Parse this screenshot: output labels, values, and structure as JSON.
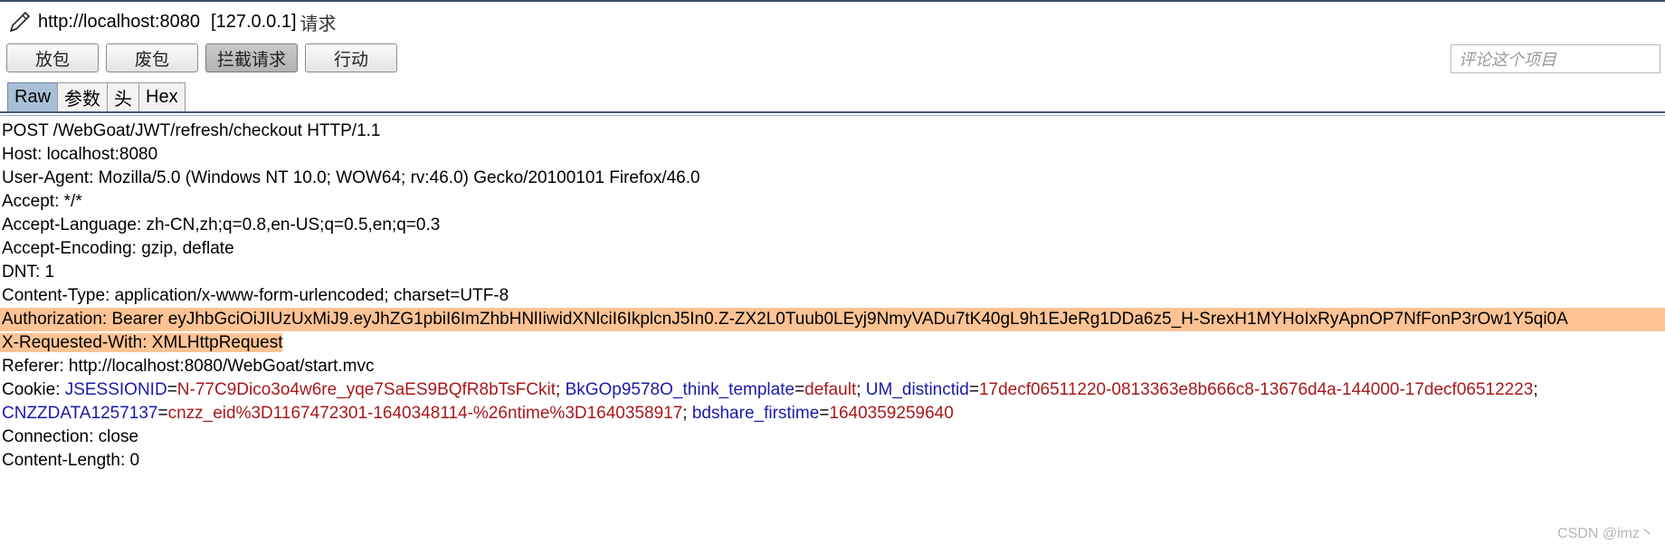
{
  "window": {
    "url": "http://localhost:8080",
    "ip": "[127.0.0.1]",
    "suffix": "请求"
  },
  "toolbar": {
    "forward": "放包",
    "drop": "废包",
    "intercept": "拦截请求",
    "action": "行动"
  },
  "comment": {
    "placeholder": "评论这个项目"
  },
  "tabs": [
    "Raw",
    "参数",
    "头",
    "Hex"
  ],
  "request": {
    "lines": [
      "POST /WebGoat/JWT/refresh/checkout HTTP/1.1",
      "Host: localhost:8080",
      "User-Agent: Mozilla/5.0 (Windows NT 10.0; WOW64; rv:46.0) Gecko/20100101 Firefox/46.0",
      "Accept: */*",
      "Accept-Language: zh-CN,zh;q=0.8,en-US;q=0.5,en;q=0.3",
      "Accept-Encoding: gzip, deflate",
      "DNT: 1",
      "Content-Type: application/x-www-form-urlencoded; charset=UTF-8",
      "Authorization: Bearer eyJhbGciOiJIUzUxMiJ9.eyJhZG1pbiI6ImZhbHNlIiwidXNlciI6IkplcnJ5In0.Z-ZX2L0Tuub0LEyj9NmyVADu7tK40gL9h1EJeRg1DDa6z5_H-SrexH1MYHoIxRyApnOP7NfFonP3rOw1Y5qi0A",
      "X-Requested-With: XMLHttpRequest",
      "Referer: http://localhost:8080/WebGoat/start.mvc"
    ],
    "cookie_label": "Cookie: ",
    "cookie_line1": {
      "n1": "JSESSIONID",
      "v1": "N-77C9Dico3o4w6re_yqe7SaES9BQfR8bTsFCkit",
      "n2": "BkGOp9578O_think_template",
      "v2": "default",
      "n3": "UM_distinctid",
      "v3": "17decf06511220-0813363e8b666c8-13676d4a-144000-17decf06512223"
    },
    "cookie_line2": {
      "n4": "CNZZDATA1257137",
      "v4": "cnzz_eid%3D1167472301-1640348114-%26ntime%3D1640358917",
      "n5": "bdshare_firstime",
      "v5": "1640359259640"
    },
    "tail": [
      "Connection: close",
      "Content-Length: 0"
    ]
  },
  "watermark": "CSDN @imz丶",
  "colors": {
    "highlight": "#fdc395",
    "cookie_name": "#1a1aaa",
    "cookie_value": "#a8191b",
    "active_tab": "#a9bfd6"
  }
}
